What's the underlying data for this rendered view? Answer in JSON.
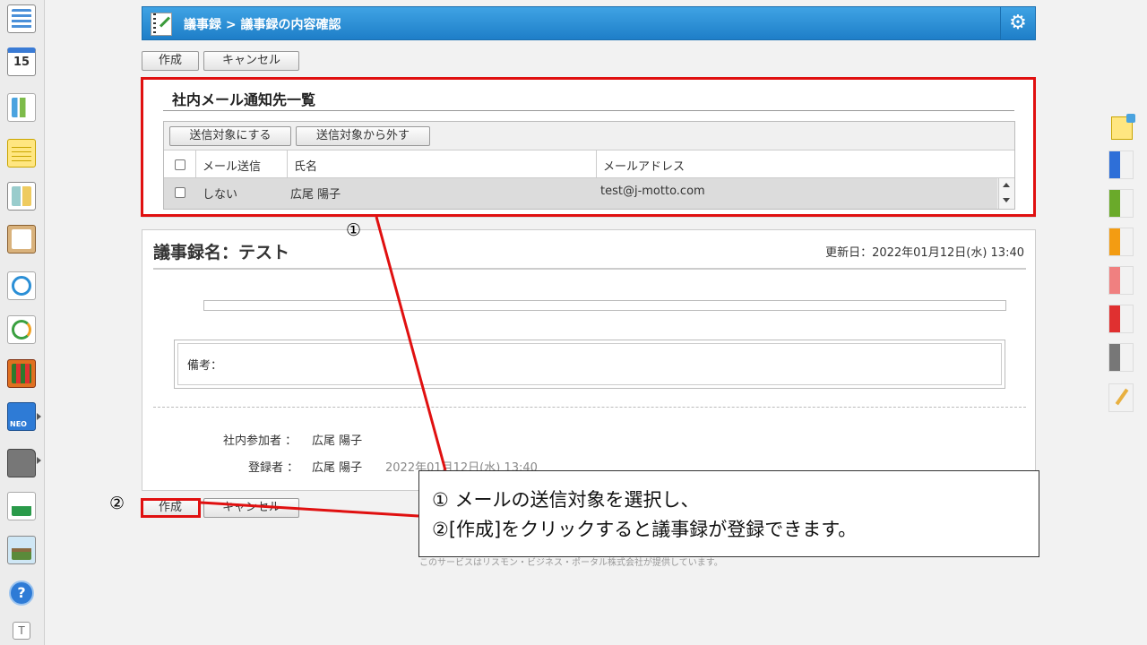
{
  "header": {
    "title": "議事録 > 議事録の内容確認",
    "notebook_icon": "notebook-pen-icon",
    "settings_icon": "gear-icon"
  },
  "toolbar": {
    "create_label": "作成",
    "cancel_label": "キャンセル"
  },
  "mail_notify": {
    "title": "社内メール通知先一覧",
    "actions": {
      "set_target_label": "送信対象にする",
      "remove_target_label": "送信対象から外す"
    },
    "columns": {
      "send": "メール送信",
      "name": "氏名",
      "email": "メールアドレス"
    },
    "rows": [
      {
        "send": "しない",
        "name": "広尾 陽子",
        "email": "test@j-motto.com",
        "checked": false
      }
    ]
  },
  "minutes": {
    "name_label": "議事録名：テスト",
    "updated": "更新日：2022年01月12日(水) 13:40",
    "remarks_label": "備考：",
    "participants_label": "社内参加者 ：",
    "participants_value": "広尾 陽子",
    "registrant_label": "登録者 ：",
    "registrant_value": "広尾 陽子",
    "registered_at": "2022年01月12日(水) 13:40"
  },
  "bottom_toolbar": {
    "create_label": "作成",
    "cancel_label": "キャンセル"
  },
  "footer": {
    "text": "このサービスはリスモン・ビジネス・ポータル株式会社が提供しています。"
  },
  "annotations": {
    "marker_1": "①",
    "marker_2": "②",
    "instruction_line_1": "① メールの送信対象を選択し、",
    "instruction_line_2": "②[作成]をクリックすると議事録が登録できます。",
    "highlight_color": "#e01010"
  },
  "sidebar_icons": [
    "portal-icon",
    "calendar-icon",
    "workflow-icon",
    "memo-icon",
    "board-icon",
    "clipboard-icon",
    "search-check-icon",
    "sync-icon",
    "binder-icon",
    "neo-icon",
    "folder-icon",
    "app-link-icon",
    "map-icon",
    "help-icon",
    "text-icon"
  ],
  "calendar_day": "15",
  "right_tags": [
    "#2e6fd8",
    "#6aaa2a",
    "#f39c12",
    "#f08080",
    "#e03030",
    "#777777"
  ]
}
